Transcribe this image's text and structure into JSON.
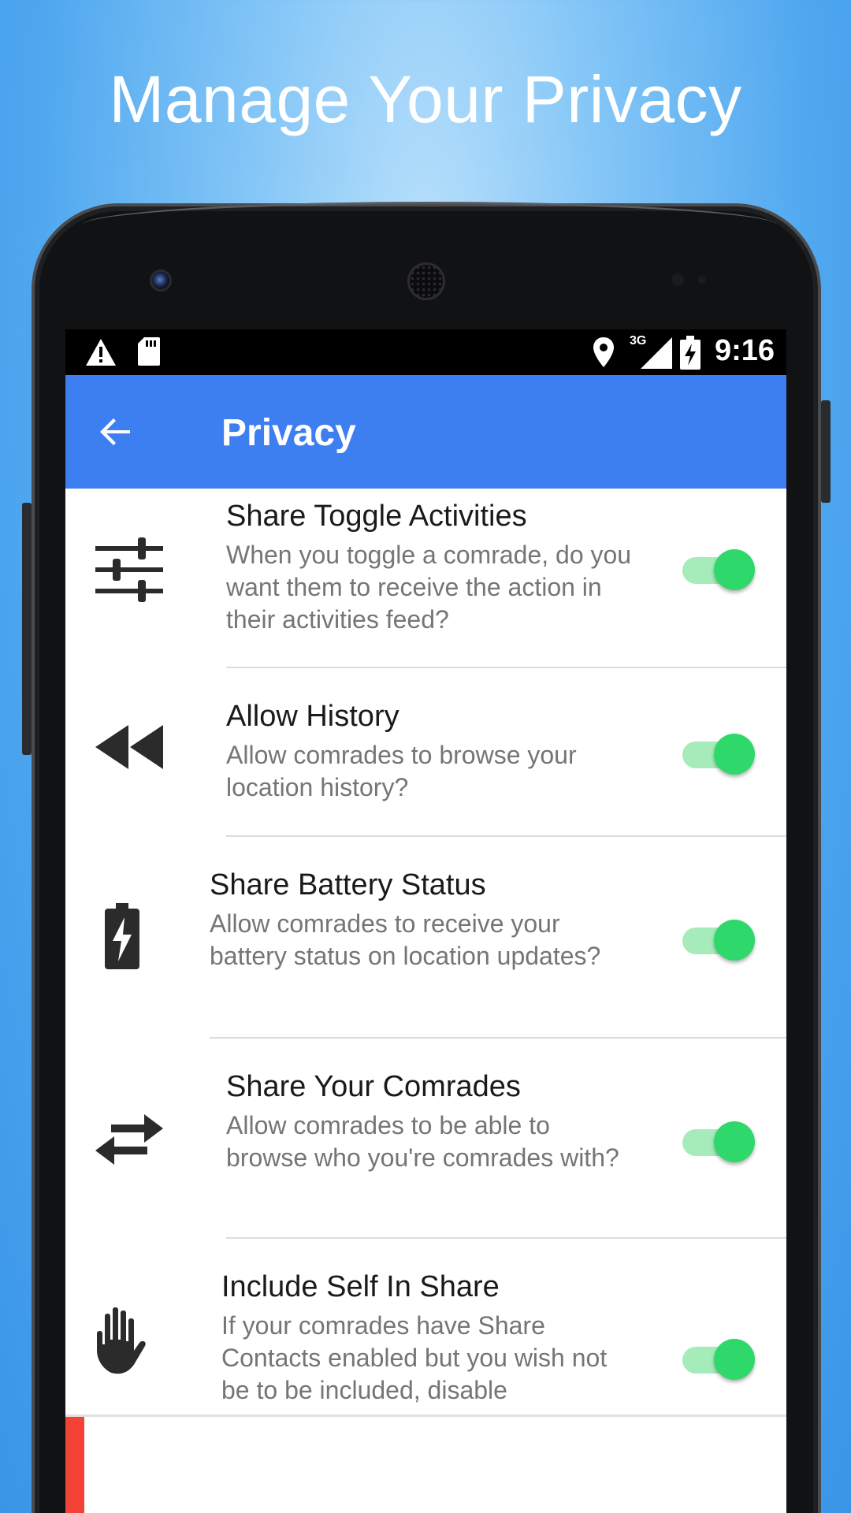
{
  "headline": "Manage Your Privacy",
  "status_bar": {
    "time": "9:16",
    "network_label": "3G",
    "icons": [
      "warning-icon",
      "sd-card-icon",
      "location-icon",
      "signal-icon",
      "battery-charging-icon"
    ]
  },
  "app_bar": {
    "title": "Privacy",
    "back_icon": "arrow-left-icon",
    "color": "#3d7ef0"
  },
  "settings": [
    {
      "icon": "tune-sliders-icon",
      "title": "Share Toggle Activities",
      "description": "When you toggle a comrade, do you want them to receive the action in their activities feed?",
      "enabled": true
    },
    {
      "icon": "rewind-icon",
      "title": "Allow History",
      "description": "Allow comrades to browse your location history?",
      "enabled": true
    },
    {
      "icon": "battery-charging-icon",
      "title": "Share Battery Status",
      "description": "Allow comrades to receive your battery status on location updates?",
      "enabled": true
    },
    {
      "icon": "swap-arrows-icon",
      "title": "Share Your Comrades",
      "description": "Allow comrades to be able to browse who you're comrades with?",
      "enabled": true
    },
    {
      "icon": "hand-icon",
      "title": "Include Self In Share",
      "description": "If your comrades have Share Contacts enabled but you wish not be to be included, disable",
      "enabled": true
    }
  ],
  "colors": {
    "toggle_on": "#2fd86a",
    "toggle_track": "#a5ecba",
    "accent_red": "#f44336"
  }
}
